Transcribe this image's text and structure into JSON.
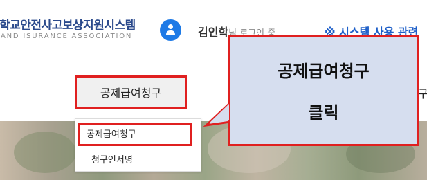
{
  "header": {
    "logo_title": "학교안전사고보상지원시스템",
    "logo_subtitle": "AND ISURANCE ASSOCIATION",
    "user_name": "김인학",
    "user_status": "님 로그인 중",
    "system_link": "※ 시스템 사용 관련"
  },
  "nav": {
    "active_item": "공제급여청구",
    "partial_item": "구"
  },
  "dropdown": {
    "items": [
      "공제급여청구",
      "청구인서명"
    ]
  },
  "callout": {
    "line1": "공제급여청구",
    "line2": "클릭"
  },
  "colors": {
    "highlight_red": "#e02020",
    "callout_bg": "#d6deef",
    "user_icon_blue": "#1e7ae6",
    "link_blue": "#1e5fc8"
  }
}
